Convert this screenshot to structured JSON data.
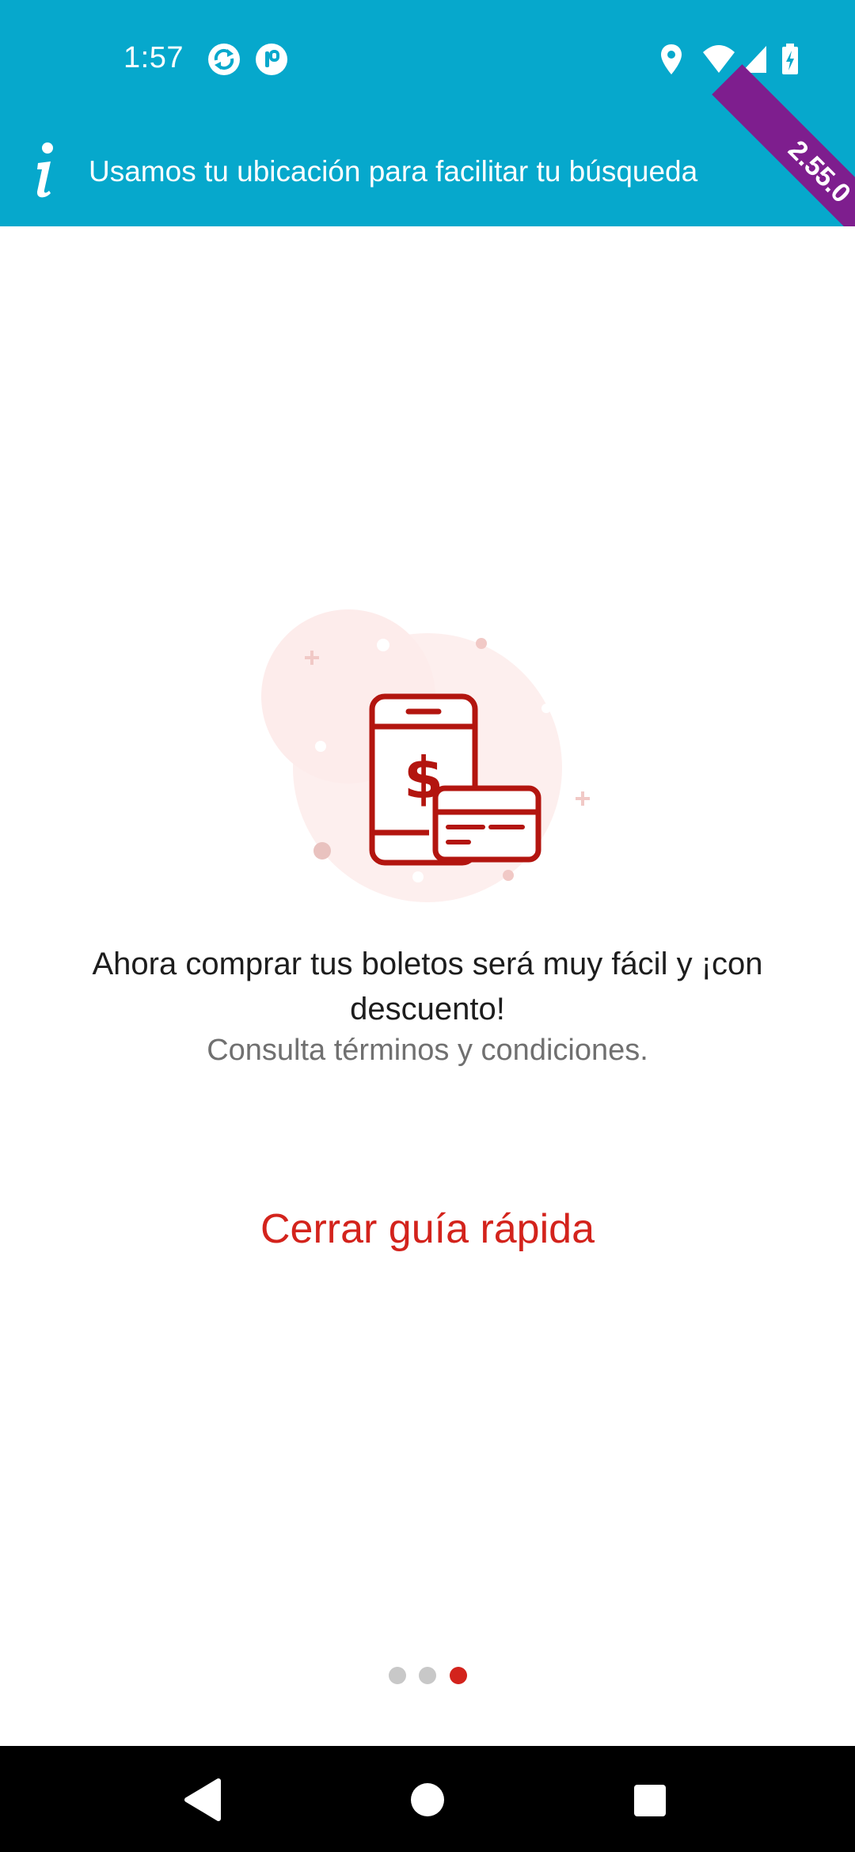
{
  "status_bar": {
    "time": "1:57",
    "icons": [
      "sync-app-icon",
      "app-badge-icon",
      "location-icon",
      "wifi-icon",
      "signal-icon",
      "battery-charging-icon"
    ]
  },
  "banner": {
    "text": "Usamos tu ubicación para facilitar tu búsqueda",
    "icon": "info-icon",
    "version": "2.55.0"
  },
  "onboarding": {
    "illustration": "phone-payment-card-icon",
    "headline": "Ahora comprar tus boletos será muy fácil y ¡con descuento!",
    "terms": "Consulta términos y condiciones.",
    "close_label": "Cerrar guía rápida",
    "pager": {
      "total": 3,
      "current": 3
    }
  },
  "navigation": {
    "buttons": [
      "back-icon",
      "home-icon",
      "recents-icon"
    ]
  },
  "colors": {
    "header": "#06a8cc",
    "accent": "#d3231c",
    "ribbon": "#7e1e8e",
    "nav_bar": "#000000"
  }
}
